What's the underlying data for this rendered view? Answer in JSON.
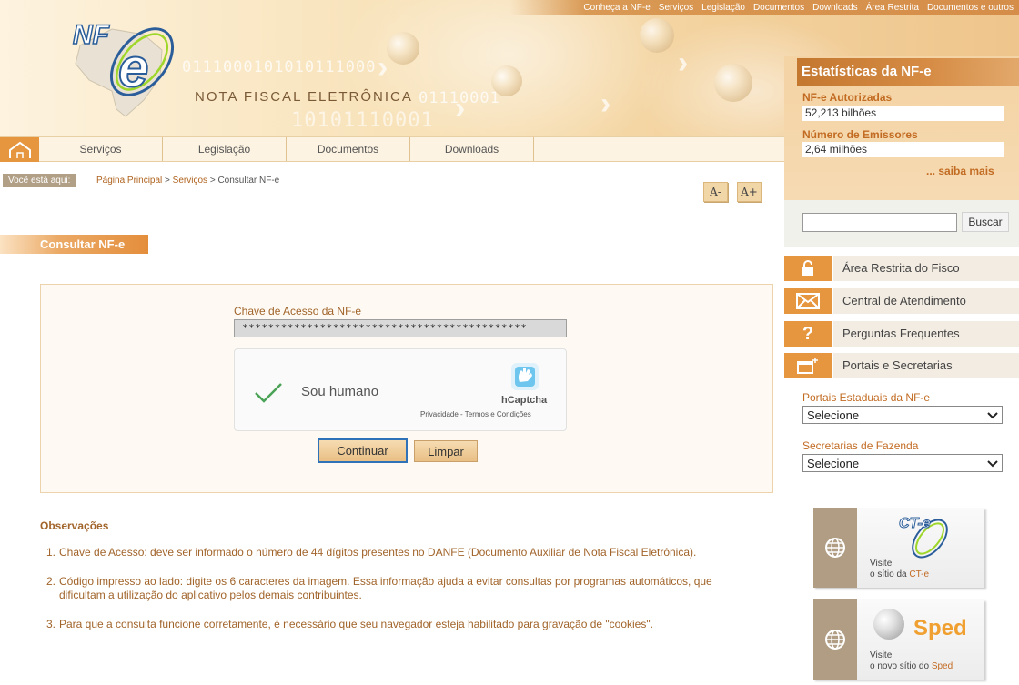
{
  "topnav": [
    "Conheça a NF-e",
    "Serviços",
    "Legislação",
    "Documentos",
    "Downloads",
    "Área Restrita",
    "Documentos e outros"
  ],
  "header": {
    "brand": "NOTA FISCAL ELETRÔNICA",
    "logo_text": "NF-e",
    "binary_1": "0111000101010111000",
    "binary_2": "01110001",
    "binary_3": "10101110001"
  },
  "mainnav": [
    "Serviços",
    "Legislação",
    "Documentos",
    "Downloads"
  ],
  "breadcrumb": {
    "you_are_here": "Você está aqui:",
    "items": [
      "Página Principal",
      "Serviços",
      "Consultar NF-e"
    ],
    "sep": ">"
  },
  "font_controls": {
    "decrease": "A-",
    "increase": "A+"
  },
  "page_title": "Consultar NF-e",
  "form": {
    "chave_label": "Chave de Acesso da NF-e",
    "chave_value": "********************************************",
    "captcha_text": "Sou humano",
    "captcha_brand": "hCaptcha",
    "captcha_links": "Privacidade - Termos e Condições",
    "btn_continuar": "Continuar",
    "btn_limpar": "Limpar"
  },
  "observacoes": {
    "title": "Observações",
    "items": [
      "Chave de Acesso: deve ser informado o número de 44 dígitos presentes no DANFE (Documento Auxiliar de Nota Fiscal Eletrônica).",
      "Código impresso ao lado: digite os 6 caracteres da imagem. Essa informação ajuda a evitar consultas por programas automáticos, que dificultam a utilização do aplicativo pelos demais contribuintes.",
      "Para que a consulta funcione corretamente, é necessário que seu navegador esteja habilitado para gravação de \"cookies\"."
    ]
  },
  "sidebar": {
    "stats_title": "Estatísticas da NF-e",
    "stat1_label": "NF-e Autorizadas",
    "stat1_value": "52,213 bilhões",
    "stat2_label": "Número de Emissores",
    "stat2_value": "2,64 milhões",
    "saiba_mais": "... saiba mais",
    "search_button": "Buscar",
    "links": [
      {
        "label": "Área Restrita do Fisco",
        "icon": "lock-icon"
      },
      {
        "label": "Central de Atendimento",
        "icon": "envelope-icon"
      },
      {
        "label": "Perguntas Frequentes",
        "icon": "question-icon"
      },
      {
        "label": "Portais e Secretarias",
        "icon": "window-icon"
      }
    ],
    "portais_label": "Portais Estaduais da NF-e",
    "portais_value": "Selecione",
    "secretarias_label": "Secretarias de Fazenda",
    "secretarias_value": "Selecione",
    "cte_banner": {
      "logo": "CT-e",
      "line1": "Visite",
      "line2_prefix": "o sítio da ",
      "line2_hl": "CT-e"
    },
    "sped_banner": {
      "logo": "Sped",
      "line1": "Visite",
      "line2_prefix": "o novo sítio do ",
      "line2_hl": "Sped"
    }
  },
  "colors": {
    "accent": "#e5963f",
    "link": "#c26b22",
    "text_brown": "#a1642a"
  }
}
